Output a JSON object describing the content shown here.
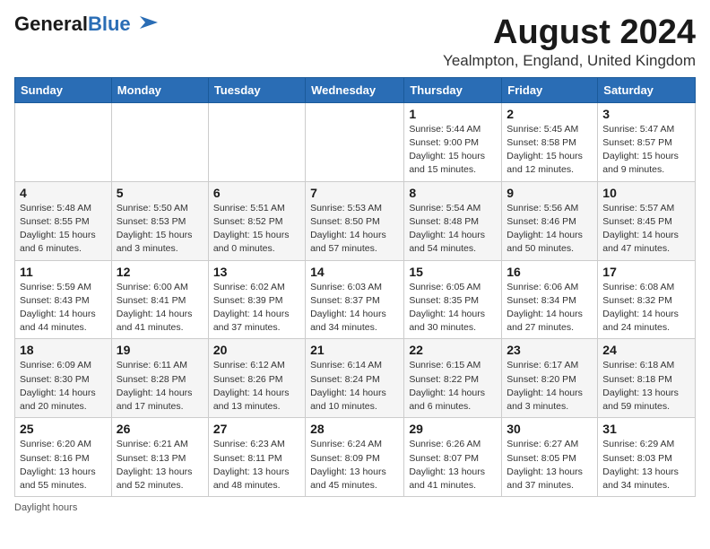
{
  "header": {
    "logo_general": "General",
    "logo_blue": "Blue",
    "month_title": "August 2024",
    "location": "Yealmpton, England, United Kingdom"
  },
  "days_of_week": [
    "Sunday",
    "Monday",
    "Tuesday",
    "Wednesday",
    "Thursday",
    "Friday",
    "Saturday"
  ],
  "weeks": [
    [
      {
        "day": "",
        "info": ""
      },
      {
        "day": "",
        "info": ""
      },
      {
        "day": "",
        "info": ""
      },
      {
        "day": "",
        "info": ""
      },
      {
        "day": "1",
        "info": "Sunrise: 5:44 AM\nSunset: 9:00 PM\nDaylight: 15 hours and 15 minutes."
      },
      {
        "day": "2",
        "info": "Sunrise: 5:45 AM\nSunset: 8:58 PM\nDaylight: 15 hours and 12 minutes."
      },
      {
        "day": "3",
        "info": "Sunrise: 5:47 AM\nSunset: 8:57 PM\nDaylight: 15 hours and 9 minutes."
      }
    ],
    [
      {
        "day": "4",
        "info": "Sunrise: 5:48 AM\nSunset: 8:55 PM\nDaylight: 15 hours and 6 minutes."
      },
      {
        "day": "5",
        "info": "Sunrise: 5:50 AM\nSunset: 8:53 PM\nDaylight: 15 hours and 3 minutes."
      },
      {
        "day": "6",
        "info": "Sunrise: 5:51 AM\nSunset: 8:52 PM\nDaylight: 15 hours and 0 minutes."
      },
      {
        "day": "7",
        "info": "Sunrise: 5:53 AM\nSunset: 8:50 PM\nDaylight: 14 hours and 57 minutes."
      },
      {
        "day": "8",
        "info": "Sunrise: 5:54 AM\nSunset: 8:48 PM\nDaylight: 14 hours and 54 minutes."
      },
      {
        "day": "9",
        "info": "Sunrise: 5:56 AM\nSunset: 8:46 PM\nDaylight: 14 hours and 50 minutes."
      },
      {
        "day": "10",
        "info": "Sunrise: 5:57 AM\nSunset: 8:45 PM\nDaylight: 14 hours and 47 minutes."
      }
    ],
    [
      {
        "day": "11",
        "info": "Sunrise: 5:59 AM\nSunset: 8:43 PM\nDaylight: 14 hours and 44 minutes."
      },
      {
        "day": "12",
        "info": "Sunrise: 6:00 AM\nSunset: 8:41 PM\nDaylight: 14 hours and 41 minutes."
      },
      {
        "day": "13",
        "info": "Sunrise: 6:02 AM\nSunset: 8:39 PM\nDaylight: 14 hours and 37 minutes."
      },
      {
        "day": "14",
        "info": "Sunrise: 6:03 AM\nSunset: 8:37 PM\nDaylight: 14 hours and 34 minutes."
      },
      {
        "day": "15",
        "info": "Sunrise: 6:05 AM\nSunset: 8:35 PM\nDaylight: 14 hours and 30 minutes."
      },
      {
        "day": "16",
        "info": "Sunrise: 6:06 AM\nSunset: 8:34 PM\nDaylight: 14 hours and 27 minutes."
      },
      {
        "day": "17",
        "info": "Sunrise: 6:08 AM\nSunset: 8:32 PM\nDaylight: 14 hours and 24 minutes."
      }
    ],
    [
      {
        "day": "18",
        "info": "Sunrise: 6:09 AM\nSunset: 8:30 PM\nDaylight: 14 hours and 20 minutes."
      },
      {
        "day": "19",
        "info": "Sunrise: 6:11 AM\nSunset: 8:28 PM\nDaylight: 14 hours and 17 minutes."
      },
      {
        "day": "20",
        "info": "Sunrise: 6:12 AM\nSunset: 8:26 PM\nDaylight: 14 hours and 13 minutes."
      },
      {
        "day": "21",
        "info": "Sunrise: 6:14 AM\nSunset: 8:24 PM\nDaylight: 14 hours and 10 minutes."
      },
      {
        "day": "22",
        "info": "Sunrise: 6:15 AM\nSunset: 8:22 PM\nDaylight: 14 hours and 6 minutes."
      },
      {
        "day": "23",
        "info": "Sunrise: 6:17 AM\nSunset: 8:20 PM\nDaylight: 14 hours and 3 minutes."
      },
      {
        "day": "24",
        "info": "Sunrise: 6:18 AM\nSunset: 8:18 PM\nDaylight: 13 hours and 59 minutes."
      }
    ],
    [
      {
        "day": "25",
        "info": "Sunrise: 6:20 AM\nSunset: 8:16 PM\nDaylight: 13 hours and 55 minutes."
      },
      {
        "day": "26",
        "info": "Sunrise: 6:21 AM\nSunset: 8:13 PM\nDaylight: 13 hours and 52 minutes."
      },
      {
        "day": "27",
        "info": "Sunrise: 6:23 AM\nSunset: 8:11 PM\nDaylight: 13 hours and 48 minutes."
      },
      {
        "day": "28",
        "info": "Sunrise: 6:24 AM\nSunset: 8:09 PM\nDaylight: 13 hours and 45 minutes."
      },
      {
        "day": "29",
        "info": "Sunrise: 6:26 AM\nSunset: 8:07 PM\nDaylight: 13 hours and 41 minutes."
      },
      {
        "day": "30",
        "info": "Sunrise: 6:27 AM\nSunset: 8:05 PM\nDaylight: 13 hours and 37 minutes."
      },
      {
        "day": "31",
        "info": "Sunrise: 6:29 AM\nSunset: 8:03 PM\nDaylight: 13 hours and 34 minutes."
      }
    ]
  ],
  "footer": {
    "note": "Daylight hours"
  }
}
